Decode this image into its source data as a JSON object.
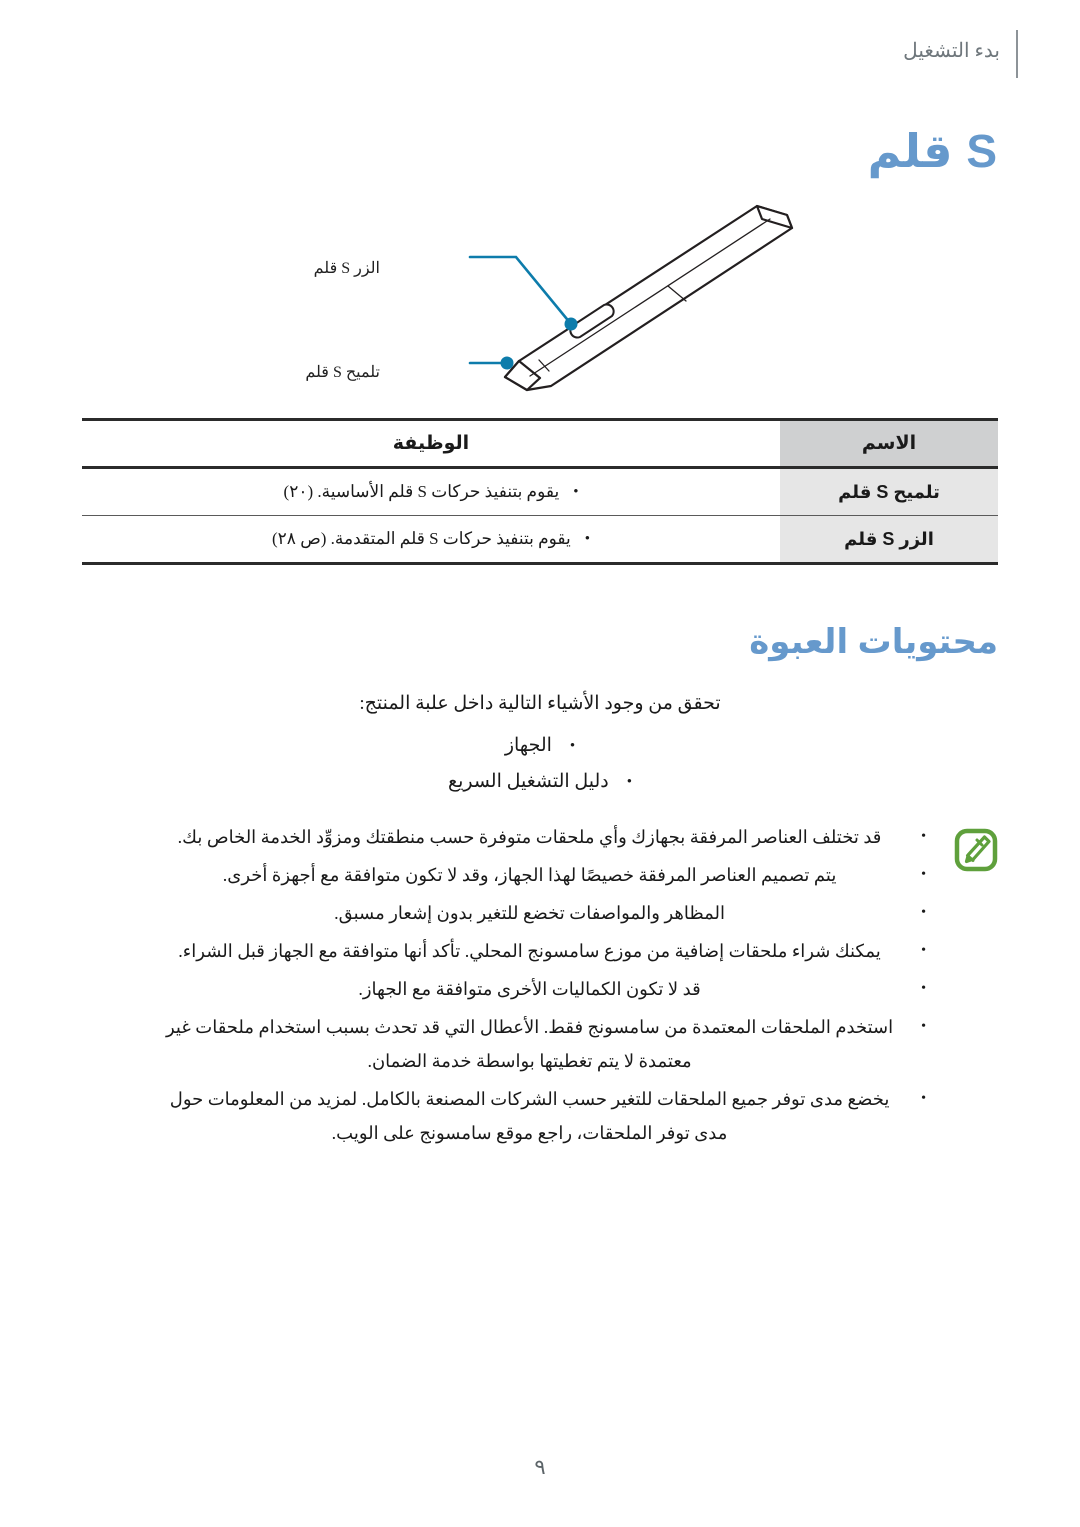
{
  "header": {
    "running_title": "بدء التشغيل"
  },
  "title": {
    "text": "S قلم"
  },
  "figure": {
    "callouts": [
      {
        "name": "s-pen-button",
        "label": "الزر S قلم"
      },
      {
        "name": "s-pen-tip",
        "label": "تلميح S قلم"
      }
    ],
    "accent_color": "#0d7cab"
  },
  "table": {
    "headers": {
      "name": "الاسم",
      "function": "الوظيفة"
    },
    "rows": [
      {
        "name": "تلميح S قلم",
        "bullet": "•",
        "function": "يقوم بتنفيذ حركات S قلم الأساسية. (٢٠)"
      },
      {
        "name": "الزر S قلم",
        "bullet": "•",
        "function": "يقوم بتنفيذ حركات S قلم المتقدمة. (ص ٢٨)"
      }
    ]
  },
  "section": {
    "heading": "محتويات العبوة",
    "intro": "تحقق من وجود الأشياء التالية داخل علبة المنتج:",
    "bullet": "•",
    "items": [
      "الجهاز",
      "دليل التشغيل السريع"
    ]
  },
  "note": {
    "icon_name": "note-pen-icon",
    "icon_color": "#5fa03c",
    "bullet": "•",
    "items": [
      "قد تختلف العناصر المرفقة بجهازك وأي ملحقات متوفرة حسب منطقتك ومزوِّد الخدمة الخاص بك.",
      "يتم تصميم العناصر المرفقة خصيصًا لهذا الجهاز، وقد لا تكون متوافقة مع أجهزة أخرى.",
      "المظاهر والمواصفات تخضع للتغير بدون إشعار مسبق.",
      "يمكنك شراء ملحقات إضافية من موزع سامسونج المحلي. تأكد أنها متوافقة مع الجهاز قبل الشراء.",
      "قد لا تكون الكماليات الأخرى متوافقة مع الجهاز.",
      "استخدم الملحقات المعتمدة من سامسونج فقط. الأعطال التي قد تحدث بسبب استخدام ملحقات غير معتمدة لا يتم تغطيتها بواسطة خدمة الضمان.",
      "يخضع مدى توفر جميع الملحقات للتغير حسب الشركات المصنعة بالكامل. لمزيد من المعلومات حول مدى توفر الملحقات، راجع موقع سامسونج على الويب."
    ]
  },
  "footer": {
    "page_number": "٩"
  },
  "colors": {
    "heading_blue": "#6699cc",
    "callout_blue": "#0d7cab",
    "note_green": "#5fa03c",
    "header_gray": "#6f777c"
  }
}
